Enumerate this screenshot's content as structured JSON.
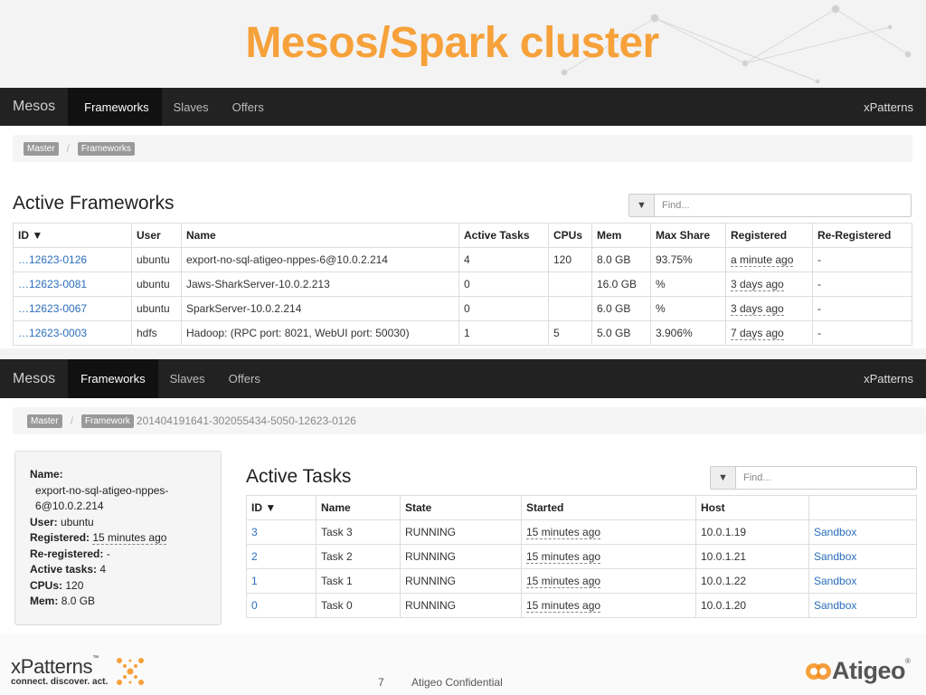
{
  "slide": {
    "title": "Mesos/Spark cluster",
    "page_number": "7",
    "confidential": "Atigeo Confidential",
    "xpatterns_logo": "xPatterns",
    "xpatterns_tm": "™",
    "xpatterns_tagline": "connect. discover. act.",
    "atigeo_logo": "Atigeo",
    "atigeo_registered": "®",
    "accent_color": "#f6a13a"
  },
  "top": {
    "navbar": {
      "brand": "Mesos",
      "items": [
        "Frameworks",
        "Slaves",
        "Offers"
      ],
      "active": "Frameworks",
      "right": "xPatterns"
    },
    "breadcrumb": [
      "Master",
      "Frameworks"
    ],
    "section_title": "Active Frameworks",
    "filter_placeholder": "Find...",
    "filter_icon": "filter-icon",
    "columns": [
      "ID ▼",
      "User",
      "Name",
      "Active Tasks",
      "CPUs",
      "Mem",
      "Max Share",
      "Registered",
      "Re-Registered"
    ],
    "rows": [
      {
        "id": "…12623-0126",
        "user": "ubuntu",
        "name": "export-no-sql-atigeo-nppes-6@10.0.2.214",
        "active_tasks": "4",
        "cpus": "120",
        "mem": "8.0 GB",
        "max_share": "93.75%",
        "registered": "a minute ago",
        "reregistered": "-"
      },
      {
        "id": "…12623-0081",
        "user": "ubuntu",
        "name": "Jaws-SharkServer-10.0.2.213",
        "active_tasks": "0",
        "cpus": "",
        "mem": "16.0 GB",
        "max_share": "%",
        "registered": "3 days ago",
        "reregistered": "-"
      },
      {
        "id": "…12623-0067",
        "user": "ubuntu",
        "name": "SparkServer-10.0.2.214",
        "active_tasks": "0",
        "cpus": "",
        "mem": "6.0 GB",
        "max_share": "%",
        "registered": "3 days ago",
        "reregistered": "-"
      },
      {
        "id": "…12623-0003",
        "user": "hdfs",
        "name": "Hadoop: (RPC port: 8021, WebUI port: 50030)",
        "active_tasks": "1",
        "cpus": "5",
        "mem": "5.0 GB",
        "max_share": "3.906%",
        "registered": "7 days ago",
        "reregistered": "-"
      }
    ]
  },
  "bottom": {
    "navbar": {
      "brand": "Mesos",
      "items": [
        "Frameworks",
        "Slaves",
        "Offers"
      ],
      "active": "Frameworks",
      "right": "xPatterns"
    },
    "breadcrumb": [
      "Master",
      "Framework"
    ],
    "breadcrumb_id": "201404191641-302055434-5050-12623-0126",
    "info": {
      "name_label": "Name:",
      "name_line1": "export-no-sql-atigeo-nppes-",
      "name_line2": "6@10.0.2.214",
      "user_label": "User:",
      "user": "ubuntu",
      "registered_label": "Registered:",
      "registered": "15 minutes ago",
      "reregistered_label": "Re-registered:",
      "reregistered": "-",
      "active_tasks_label": "Active tasks:",
      "active_tasks": "4",
      "cpus_label": "CPUs:",
      "cpus": "120",
      "mem_label": "Mem:",
      "mem": "8.0 GB"
    },
    "section_title": "Active Tasks",
    "filter_placeholder": "Find...",
    "columns": [
      "ID ▼",
      "Name",
      "State",
      "Started",
      "Host",
      ""
    ],
    "rows": [
      {
        "id": "3",
        "name": "Task 3",
        "state": "RUNNING",
        "started": "15 minutes ago",
        "host": "10.0.1.19",
        "link": "Sandbox"
      },
      {
        "id": "2",
        "name": "Task 2",
        "state": "RUNNING",
        "started": "15 minutes ago",
        "host": "10.0.1.21",
        "link": "Sandbox"
      },
      {
        "id": "1",
        "name": "Task 1",
        "state": "RUNNING",
        "started": "15 minutes ago",
        "host": "10.0.1.22",
        "link": "Sandbox"
      },
      {
        "id": "0",
        "name": "Task 0",
        "state": "RUNNING",
        "started": "15 minutes ago",
        "host": "10.0.1.20",
        "link": "Sandbox"
      }
    ]
  }
}
